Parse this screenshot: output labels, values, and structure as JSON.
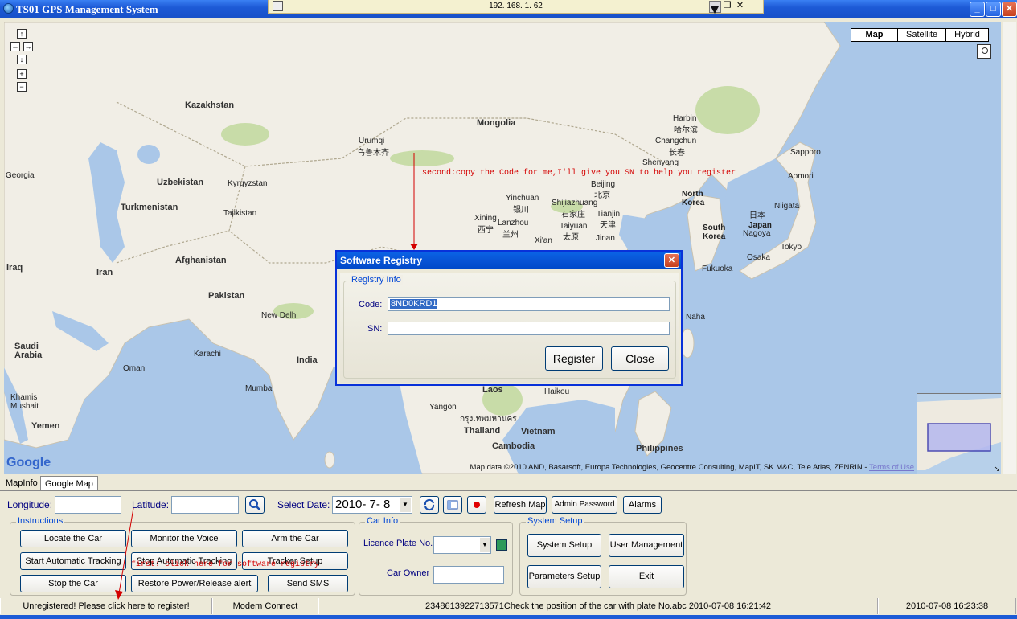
{
  "window": {
    "title": "TS01 GPS Management System",
    "controls": {
      "minimize": "_",
      "maximize": "□",
      "close": "✕"
    }
  },
  "remote_bar": {
    "address": "192. 168. 1. 62",
    "controls": {
      "minimize": "_",
      "restore": "❐",
      "close": "✕"
    }
  },
  "map": {
    "map_types": [
      "Map",
      "Satellite",
      "Hybrid"
    ],
    "pan_controls": {
      "up": "↑",
      "left": "←",
      "right": "→",
      "down": "↓",
      "zoom_in": "+",
      "zoom_out": "−"
    },
    "labels": {
      "kazakhstan": "Kazakhstan",
      "mongolia": "Mongolia",
      "uzbekistan": "Uzbekistan",
      "kyrgyzstan": "Kyrgyzstan",
      "turkmenistan": "Turkmenistan",
      "tajikistan": "Tajikistan",
      "afghanistan": "Afghanistan",
      "iran": "Iran",
      "iraq": "Iraq",
      "pakistan": "Pakistan",
      "india": "India",
      "saudi_arabia": "Saudi\nArabia",
      "oman": "Oman",
      "yemen": "Yemen",
      "georgia": "Georgia",
      "urumqi": "Urumqi",
      "urumqi_cn": "乌鲁木齐",
      "harbin": "Harbin",
      "harbin_cn": "哈尔滨",
      "changchun": "Changchun",
      "changchun_cn": "长春",
      "shenyang": "Shenyang",
      "beijing": "Beijing",
      "beijing_cn": "北京",
      "tianjin": "Tianjin",
      "tianjin_cn": "天津",
      "jinan": "Jinan",
      "yinchuan": "Yinchuan",
      "yinchuan_cn": "银川",
      "shijiazhuang": "Shijiazhuang",
      "shijiazhuang_cn": "石家庄",
      "taiyuan": "Taiyuan",
      "taiyuan_cn": "太原",
      "xining": "Xining",
      "xining_cn": "西宁",
      "lanzhou": "Lanzhou",
      "lanzhou_cn": "兰州",
      "xian": "Xi'an",
      "north_korea": "North\nKorea",
      "south_korea": "South\nKorea",
      "japan": "Japan",
      "japan_cn": "日本",
      "sapporo": "Sapporo",
      "aomori": "Aomori",
      "niigata": "Niigata",
      "tokyo": "Tokyo",
      "nagoya": "Nagoya",
      "osaka": "Osaka",
      "fukuoka": "Fukuoka",
      "naha": "Naha",
      "laos": "Laos",
      "haikou": "Haikou",
      "thailand": "Thailand",
      "vietnam": "Vietnam",
      "cambodia": "Cambodia",
      "philippines": "Philippines",
      "yangon": "Yangon",
      "new_delhi": "New Delhi",
      "karachi": "Karachi",
      "mumbai": "Mumbai",
      "khamis": "Khamis\nMushait",
      "bangkok_th": "กรุงเทพมหานคร",
      "google": "Google"
    },
    "annotation_second": "second:copy the Code for me,I'll give you SN to help you register",
    "annotation_first": "first: click here for software registry",
    "attribution": "Map data ©2010 AND, Basarsoft, Europa Technologies, Geocentre Consulting, MapIT, SK M&C, Tele Atlas, ZENRIN -",
    "terms_link": "Terms of Use"
  },
  "tabs": [
    "MapInfo",
    "Google Map"
  ],
  "controls": {
    "longitude_label": "Longitude:",
    "latitude_label": "Latitude:",
    "select_date_label": "Select Date:",
    "date_value": "2010- 7- 8",
    "refresh_map": "Refresh Map",
    "admin_password": "Admin Password",
    "alarms": "Alarms"
  },
  "instructions": {
    "title": "Instructions",
    "buttons": [
      "Locate the Car",
      "Monitor the Voice",
      "Arm the Car",
      "Start Automatic Tracking",
      "Stop Automatic Tracking",
      "Tracker Setup",
      "Stop the Car",
      "Restore Power/Release alert",
      "Send SMS"
    ]
  },
  "car_info": {
    "title": "Car Info",
    "licence_label": "Licence Plate No.",
    "owner_label": "Car Owner"
  },
  "system_setup": {
    "title": "System Setup",
    "buttons": [
      "System Setup",
      "User Management",
      "Parameters Setup",
      "Exit"
    ]
  },
  "status_bar": {
    "register": "Unregistered! Please click here to register!",
    "modem": "Modem Connect",
    "message": "2348613922713571Check the position of the car with plate No.abc 2010-07-08 16:21:42",
    "datetime": "2010-07-08 16:23:38"
  },
  "dialog": {
    "title": "Software Registry",
    "group_title": "Registry Info",
    "code_label": "Code:",
    "code_value": "8ND0KRD1",
    "sn_label": "SN:",
    "sn_value": "",
    "register": "Register",
    "close": "Close",
    "close_glyph": "✕"
  },
  "colors": {
    "titlebar": "#1d5ad6",
    "water": "#aac7e8",
    "land": "#f1eee6",
    "annotation": "#d40000",
    "group_title": "#0046d5"
  }
}
